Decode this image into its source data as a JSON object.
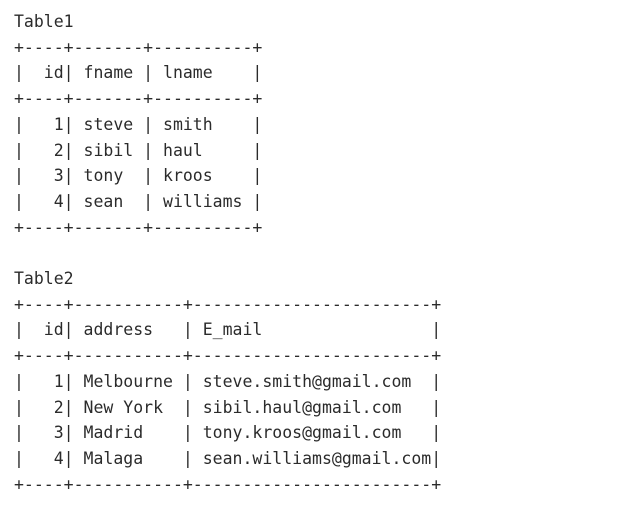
{
  "terminal": {
    "background_color": "#ffffff",
    "text_color": "#2b2b2b"
  },
  "tables": [
    {
      "caption": "Table1",
      "columns": [
        {
          "name": "id",
          "width": 4,
          "align": "right"
        },
        {
          "name": "fname",
          "width": 7,
          "align": "left"
        },
        {
          "name": "lname",
          "width": 10,
          "align": "left"
        }
      ],
      "rows": [
        [
          "1",
          "steve",
          "smith"
        ],
        [
          "2",
          "sibil",
          "haul"
        ],
        [
          "3",
          "tony",
          "kroos"
        ],
        [
          "4",
          "sean",
          "williams"
        ]
      ]
    },
    {
      "caption": "Table2",
      "columns": [
        {
          "name": "id",
          "width": 4,
          "align": "right"
        },
        {
          "name": "address",
          "width": 11,
          "align": "left"
        },
        {
          "name": "E_mail",
          "width": 24,
          "align": "left"
        }
      ],
      "rows": [
        [
          "1",
          "Melbourne",
          "steve.smith@gmail.com"
        ],
        [
          "2",
          "New York",
          "sibil.haul@gmail.com"
        ],
        [
          "3",
          "Madrid",
          "tony.kroos@gmail.com"
        ],
        [
          "4",
          "Malaga",
          "sean.williams@gmail.com"
        ]
      ]
    }
  ],
  "border_chars": {
    "corner": "+",
    "horizontal": "-",
    "vertical": "|"
  }
}
